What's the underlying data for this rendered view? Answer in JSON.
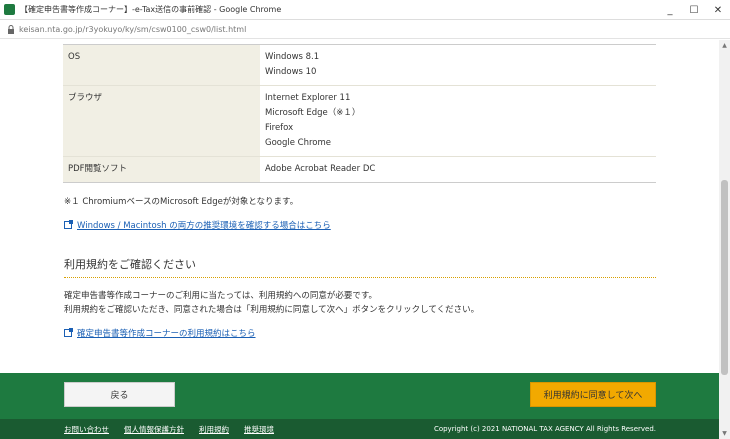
{
  "window": {
    "title": "【確定申告書等作成コーナー】-e-Tax送信の事前確認 - Google Chrome",
    "controls": {
      "minimize": "_",
      "maximize": "☐",
      "close": "✕"
    }
  },
  "address_bar": {
    "url": "keisan.nta.go.jp/r3yokuyo/ky/sm/csw0100_csw0/list.html"
  },
  "environment_table": {
    "rows": [
      {
        "key": "OS",
        "values": [
          "Windows 8.1",
          "Windows 10"
        ]
      },
      {
        "key": "ブラウザ",
        "values": [
          "Internet Explorer 11",
          "Microsoft Edge（※１）",
          "Firefox",
          "Google Chrome"
        ]
      },
      {
        "key": "PDF閲覧ソフト",
        "values": [
          "Adobe Acrobat Reader DC"
        ]
      }
    ]
  },
  "note": "※１ ChromiumベースのMicrosoft Edgeが対象となります。",
  "mac_link": "Windows / Macintosh の両方の推奨環境を確認する場合はこちら",
  "terms_section": {
    "heading": "利用規約をご確認ください",
    "para1": "確定申告書等作成コーナーのご利用に当たっては、利用規約への同意が必要です。",
    "para2": "利用規約をご確認いただき、同意された場合は「利用規約に同意して次へ」ボタンをクリックしてください。",
    "link": "確定申告書等作成コーナーの利用規約はこちら"
  },
  "footer": {
    "back_label": "戻る",
    "agree_label": "利用規約に同意して次へ",
    "links": [
      "お問い合わせ",
      "個人情報保護方針",
      "利用規約",
      "推奨環境"
    ],
    "copyright": "Copyright (c) 2021 NATIONAL TAX AGENCY All Rights Reserved."
  },
  "colors": {
    "footer_green": "#1e7a40",
    "footer_dark_green": "#1a5b31",
    "agree_orange": "#f2a900",
    "link_blue": "#1a5fb4",
    "table_key_bg": "#f1efe4"
  }
}
